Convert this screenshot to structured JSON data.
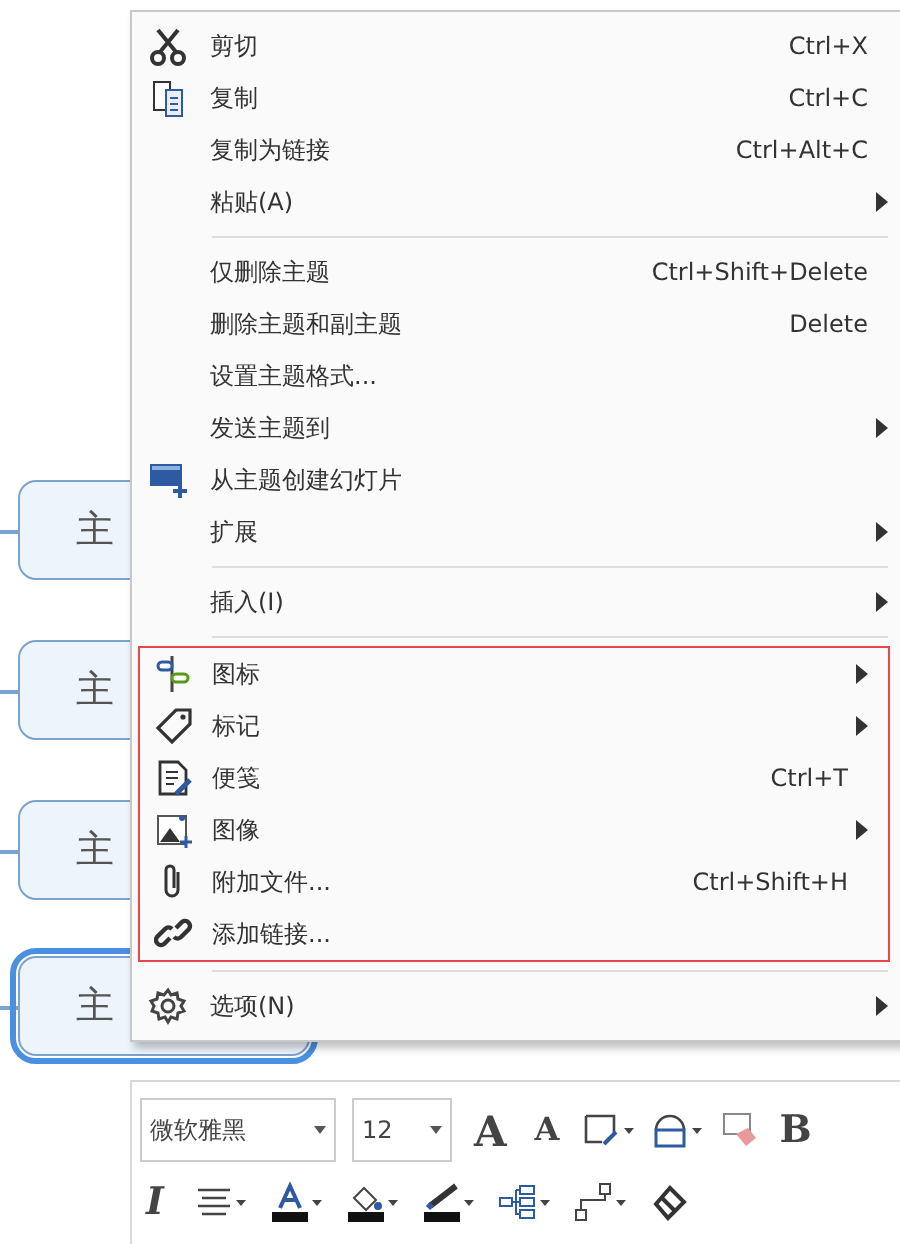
{
  "topics": [
    {
      "text": "主",
      "selected": false
    },
    {
      "text": "主",
      "selected": false
    },
    {
      "text": "主",
      "selected": false
    },
    {
      "text": "主",
      "selected": true
    }
  ],
  "menu": {
    "sections": [
      {
        "highlighted": false,
        "items": [
          {
            "label": "剪切",
            "shortcut": "Ctrl+X",
            "submenu": false
          },
          {
            "label": "复制",
            "shortcut": "Ctrl+C",
            "submenu": false
          },
          {
            "label": "复制为链接",
            "shortcut": "Ctrl+Alt+C",
            "submenu": false
          },
          {
            "label": "粘贴(A)",
            "submenu": true
          }
        ]
      },
      {
        "highlighted": false,
        "items": [
          {
            "label": "仅删除主题",
            "shortcut": "Ctrl+Shift+Delete",
            "submenu": false
          },
          {
            "label": "删除主题和副主题",
            "shortcut": "Delete",
            "submenu": false
          },
          {
            "label": "设置主题格式...",
            "submenu": false
          },
          {
            "label": "发送主题到",
            "submenu": true
          },
          {
            "label": "从主题创建幻灯片",
            "submenu": false
          },
          {
            "label": "扩展",
            "submenu": true
          }
        ]
      },
      {
        "highlighted": false,
        "items": [
          {
            "label": "插入(I)",
            "submenu": true
          }
        ]
      },
      {
        "highlighted": true,
        "items": [
          {
            "label": "图标",
            "submenu": true
          },
          {
            "label": "标记",
            "submenu": true
          },
          {
            "label": "便笺",
            "shortcut": "Ctrl+T",
            "submenu": false
          },
          {
            "label": "图像",
            "submenu": true
          },
          {
            "label": "附加文件...",
            "shortcut": "Ctrl+Shift+H",
            "submenu": false
          },
          {
            "label": "添加链接...",
            "submenu": false
          }
        ]
      },
      {
        "highlighted": false,
        "items": [
          {
            "label": "选项(N)",
            "submenu": true
          }
        ]
      }
    ]
  },
  "toolbar": {
    "font": "微软雅黑",
    "size": "12",
    "grow_font": "A",
    "shrink_font": "A",
    "bold": "B",
    "italic": "I"
  }
}
